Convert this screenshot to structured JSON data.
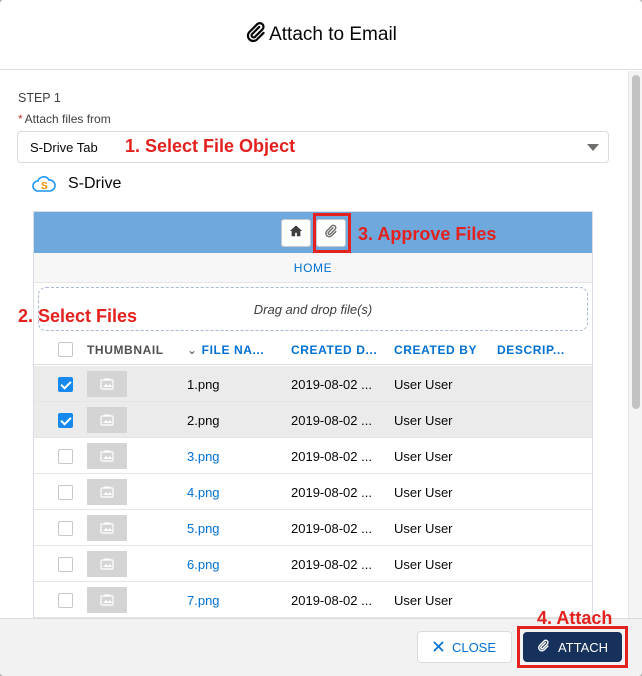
{
  "modal": {
    "title": "Attach to Email",
    "step_label": "STEP 1",
    "required_marker": "*",
    "field_label": "Attach files from",
    "source_select_value": "S-Drive Tab"
  },
  "annotations": {
    "step1": "1. Select File Object",
    "step2": "2. Select Files",
    "step3": "3. Approve Files",
    "step4": "4. Attach"
  },
  "sdrive": {
    "brand_name": "S-Drive",
    "breadcrumb": "HOME",
    "dropzone_text": "Drag and drop file(s)",
    "toolbar_colors": {
      "toolbar": "#6ea8dc"
    }
  },
  "table": {
    "columns": {
      "thumbnail": "THUMBNAIL",
      "file_name": "FILE NA...",
      "created_date": "CREATED D...",
      "created_by": "CREATED BY",
      "description": "DESCRIP..."
    },
    "rows": [
      {
        "selected": true,
        "name": "1.png",
        "created": "2019-08-02 ...",
        "by": "User User"
      },
      {
        "selected": true,
        "name": "2.png",
        "created": "2019-08-02 ...",
        "by": "User User"
      },
      {
        "selected": false,
        "name": "3.png",
        "created": "2019-08-02 ...",
        "by": "User User"
      },
      {
        "selected": false,
        "name": "4.png",
        "created": "2019-08-02 ...",
        "by": "User User"
      },
      {
        "selected": false,
        "name": "5.png",
        "created": "2019-08-02 ...",
        "by": "User User"
      },
      {
        "selected": false,
        "name": "6.png",
        "created": "2019-08-02 ...",
        "by": "User User"
      },
      {
        "selected": false,
        "name": "7.png",
        "created": "2019-08-02 ...",
        "by": "User User"
      }
    ]
  },
  "footer": {
    "close_label": "CLOSE",
    "attach_label": "ATTACH"
  },
  "icons": {
    "title": "paperclip-icon",
    "home": "home-icon",
    "approve": "paperclip-icon",
    "close": "close-icon",
    "attach": "paperclip-icon",
    "brand": "sdrive-cloud-icon",
    "thumbnail": "image-placeholder-icon"
  },
  "colors": {
    "annotation": "#e3211e",
    "link": "#0070d2",
    "attach_button": "#16325c",
    "checkbox": "#1589ee"
  }
}
